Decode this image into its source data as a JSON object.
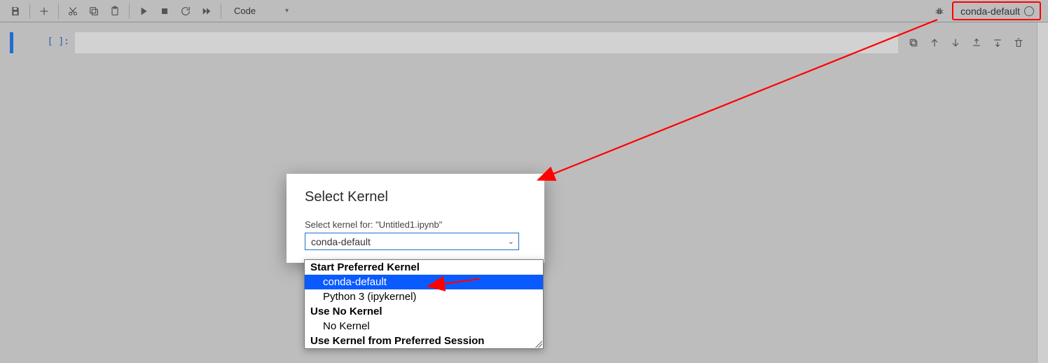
{
  "toolbar": {
    "cell_type": "Code",
    "kernel_name": "conda-default"
  },
  "cell": {
    "prompt": "[ ]:"
  },
  "dialog": {
    "title": "Select Kernel",
    "subtitle": "Select kernel for: \"Untitled1.ipynb\"",
    "selected": "conda-default"
  },
  "dropdown": {
    "group_start": "Start Preferred Kernel",
    "item_conda": "conda-default",
    "item_py3": "Python 3 (ipykernel)",
    "group_none": "Use No Kernel",
    "item_nokernel": "No Kernel",
    "group_session": "Use Kernel from Preferred Session"
  }
}
